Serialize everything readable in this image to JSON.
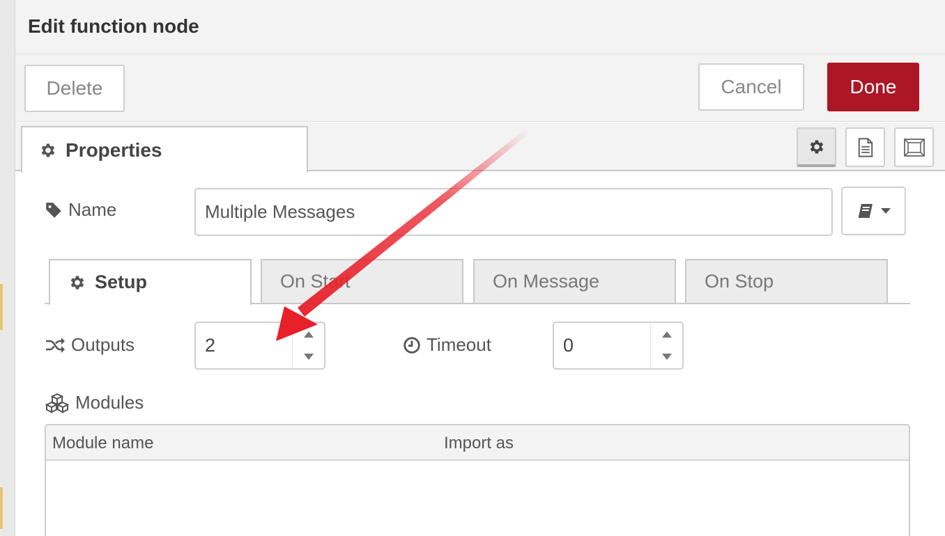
{
  "dialog": {
    "title": "Edit function node"
  },
  "toolbar": {
    "delete_label": "Delete",
    "cancel_label": "Cancel",
    "done_label": "Done"
  },
  "tabs": {
    "properties_label": "Properties",
    "side_buttons": [
      "gear-icon",
      "file-text-icon",
      "expand-icon"
    ]
  },
  "name_field": {
    "label": "Name",
    "value": "Multiple Messages"
  },
  "subtabs": [
    {
      "label": "Setup",
      "active": true
    },
    {
      "label": "On Start",
      "active": false
    },
    {
      "label": "On Message",
      "active": false
    },
    {
      "label": "On Stop",
      "active": false
    }
  ],
  "outputs": {
    "label": "Outputs",
    "value": "2"
  },
  "timeout": {
    "label": "Timeout",
    "value": "0"
  },
  "modules": {
    "label": "Modules",
    "columns": [
      "Module name",
      "Import as"
    ]
  },
  "colors": {
    "accent": "#ad1625",
    "annotation_arrow": "#e8202a"
  }
}
